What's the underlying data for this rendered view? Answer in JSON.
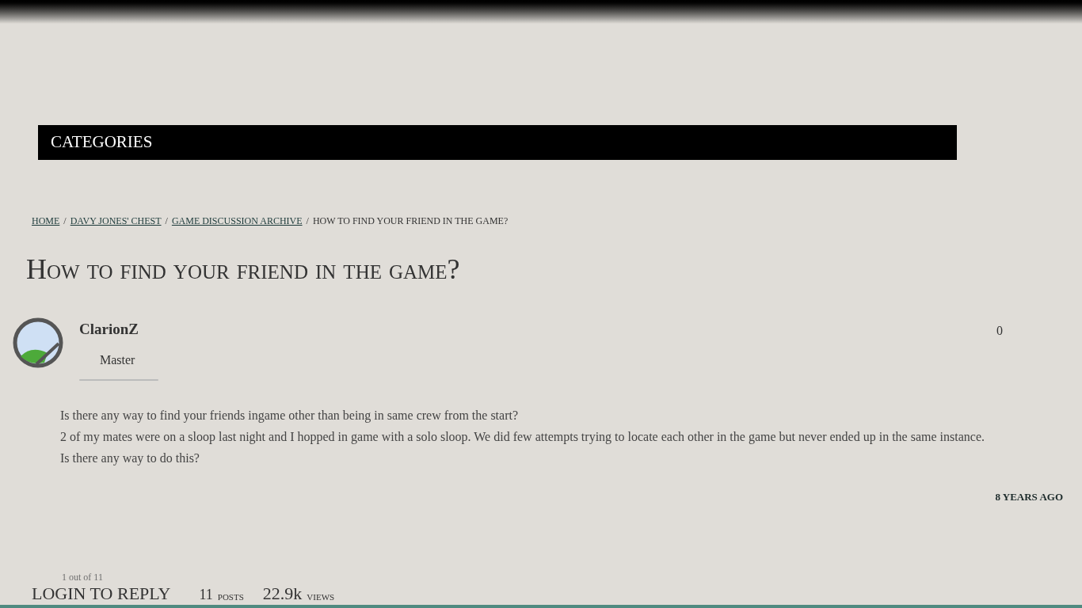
{
  "nav": {
    "label": "CATEGORIES"
  },
  "breadcrumb": {
    "links": [
      "HOME",
      "DAVY JONES' CHEST",
      "GAME DISCUSSION ARCHIVE"
    ],
    "separator": "/",
    "current": "HOW TO FIND YOUR FRIEND IN THE GAME?"
  },
  "title": "How to find your friend in the game?",
  "post": {
    "author": "ClarionZ",
    "rank": "Master",
    "votes": "0",
    "paragraphs": [
      "Is there any way to find your friends ingame other than being in same crew from the start?",
      "2 of my mates were on a sloop last night and I hopped in game with a solo sloop. We did few attempts trying to locate each other in the game but never ended up in the same instance.",
      "Is there any way to do this?"
    ],
    "time": "8 YEARS AGO"
  },
  "footer": {
    "pager": "1 out of 11",
    "reply": "LOGIN TO REPLY",
    "posts_count": "11",
    "posts_label": "POSTS",
    "views_count": "22.9k",
    "views_label": "VIEWS"
  }
}
